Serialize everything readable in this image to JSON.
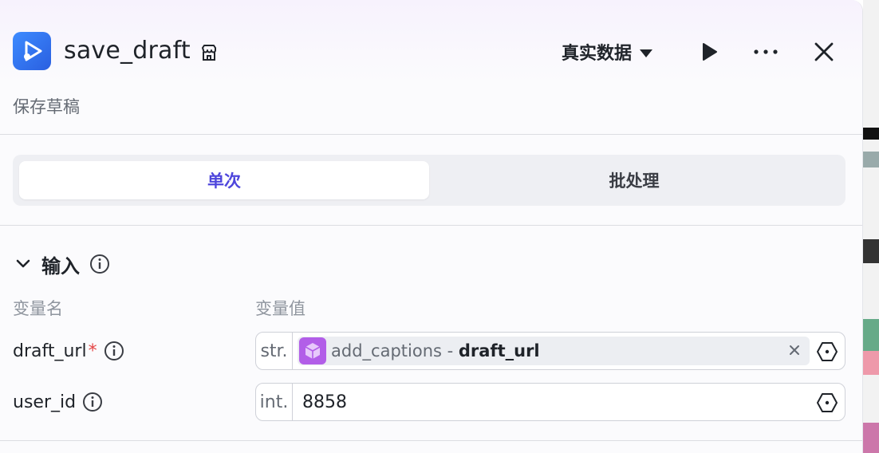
{
  "header": {
    "title": "save_draft",
    "subtitle": "保存草稿",
    "mode_label": "真实数据"
  },
  "tabs": [
    {
      "label": "单次",
      "active": true
    },
    {
      "label": "批处理",
      "active": false
    }
  ],
  "input_section": {
    "title": "输入",
    "column_name": "变量名",
    "column_value": "变量值",
    "rows": [
      {
        "name": "draft_url",
        "required_mark": "*",
        "type": "str.",
        "ref_node": "add_captions",
        "ref_sep": " - ",
        "ref_field": "draft_url"
      },
      {
        "name": "user_id",
        "type": "int.",
        "value": "8858"
      }
    ]
  },
  "colors": {
    "accent": "#4e46dc",
    "app_icon": "#2f6cf0",
    "ref_icon": "#b25ee8",
    "required": "#e54545"
  }
}
